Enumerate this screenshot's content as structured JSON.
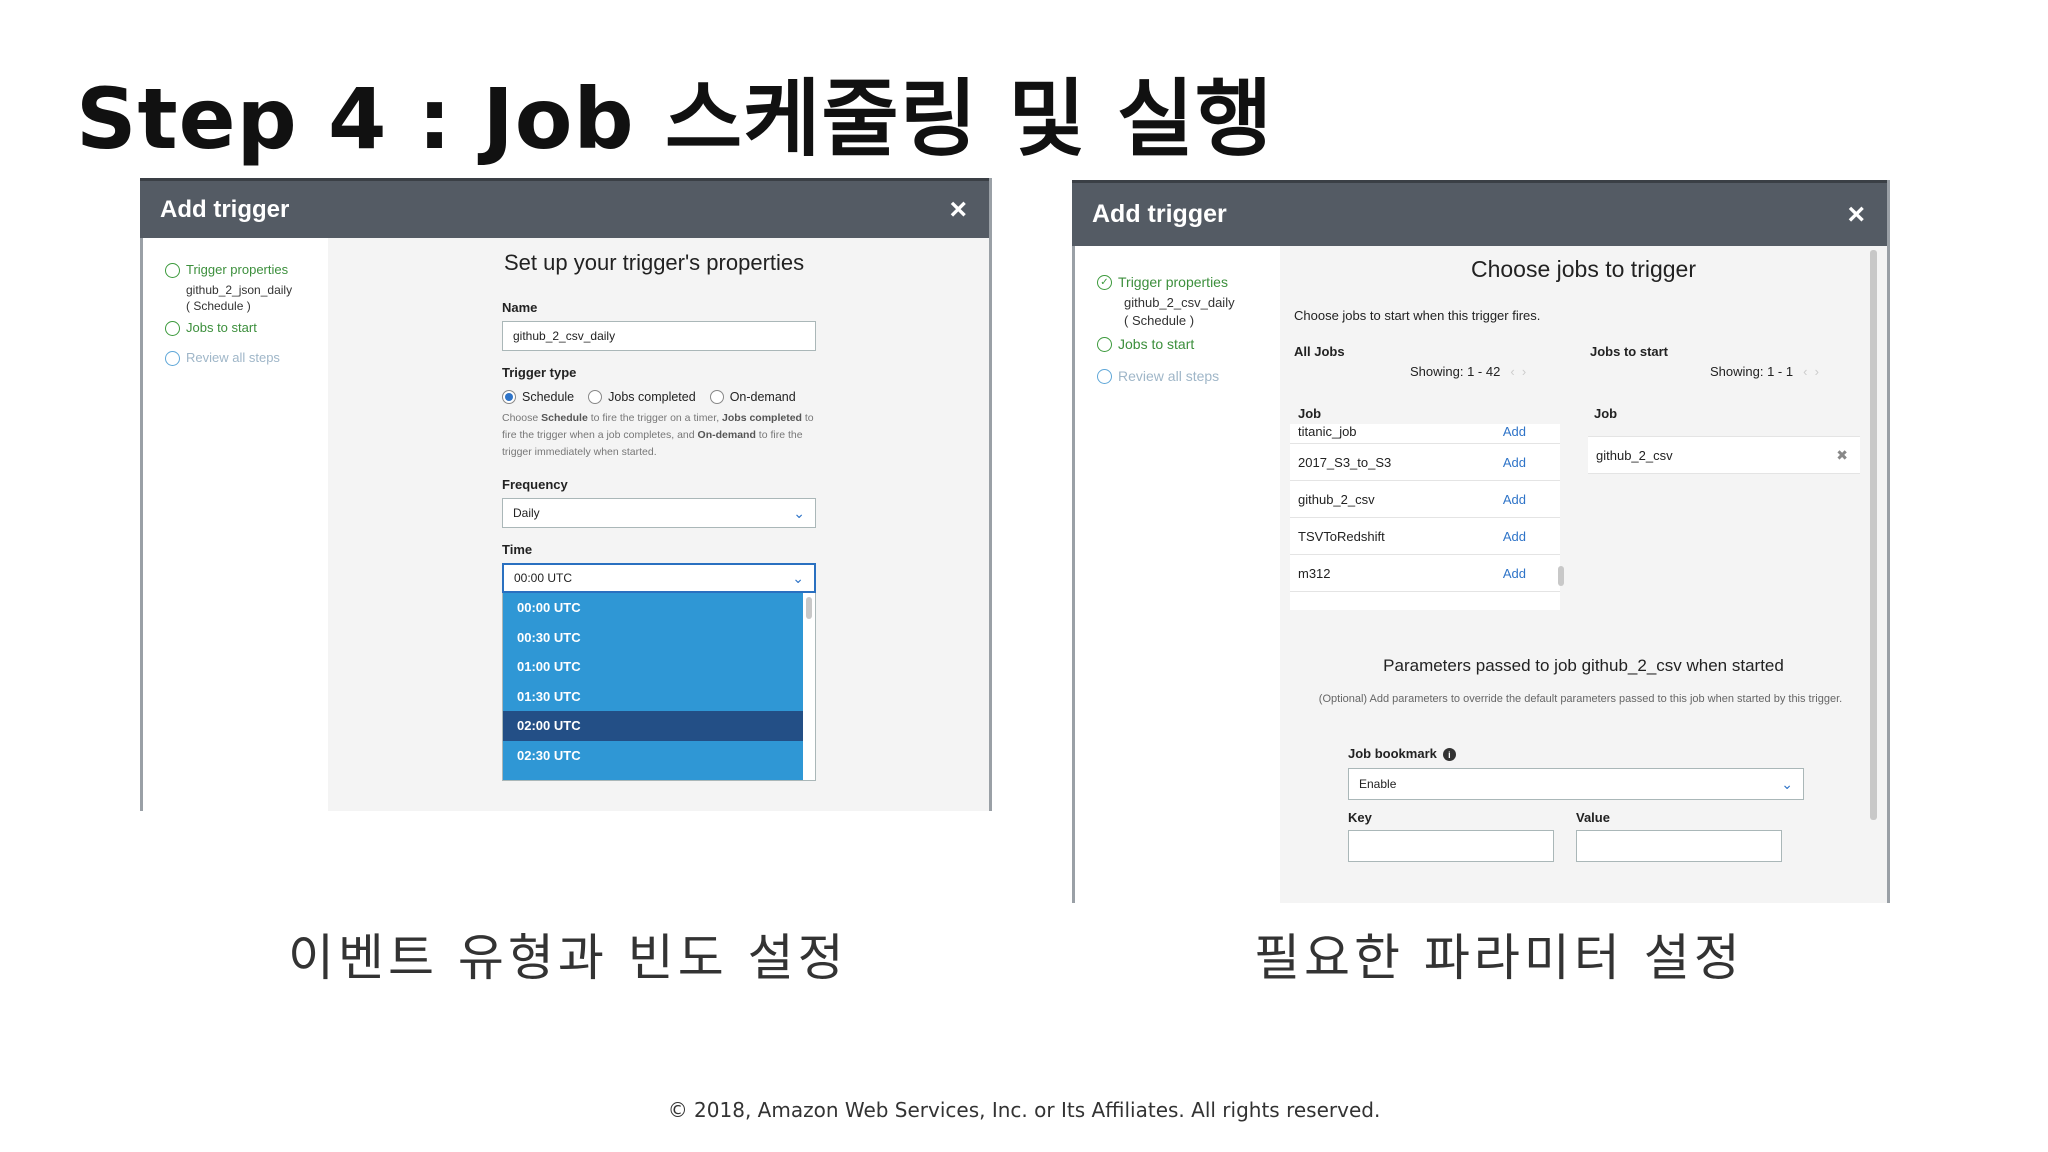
{
  "slide": {
    "title": "Step 4 : Job 스케줄링 및 실행",
    "caption_left": "이벤트 유형과 빈도 설정",
    "caption_right": "필요한 파라미터 설정",
    "footer": "© 2018, Amazon Web Services, Inc. or Its Affiliates. All rights reserved."
  },
  "left_dialog": {
    "title": "Add trigger",
    "close_icon": "×",
    "steps": [
      {
        "label": "Trigger properties",
        "sub": [
          "github_2_json_daily",
          "( Schedule )"
        ]
      },
      {
        "label": "Jobs to start"
      },
      {
        "label": "Review all steps"
      }
    ],
    "heading": "Set up your trigger's properties",
    "name_label": "Name",
    "name_value": "github_2_csv_daily",
    "trigger_type_label": "Trigger type",
    "trigger_options": [
      "Schedule",
      "Jobs completed",
      "On-demand"
    ],
    "selected_trigger": "Schedule",
    "help": {
      "p1": "Choose ",
      "b1": "Schedule",
      "p2": " to fire the trigger on a timer, ",
      "b2": "Jobs completed",
      "p3": " to fire the trigger when a job completes, and ",
      "b3": "On-demand",
      "p4": " to fire the trigger immediately when started."
    },
    "frequency_label": "Frequency",
    "frequency_value": "Daily",
    "time_label": "Time",
    "time_value": "00:00 UTC",
    "time_options": [
      "00:00 UTC",
      "00:30 UTC",
      "01:00 UTC",
      "01:30 UTC",
      "02:00 UTC",
      "02:30 UTC"
    ],
    "time_highlighted": "02:00 UTC"
  },
  "right_dialog": {
    "title": "Add trigger",
    "close_icon": "×",
    "steps": [
      {
        "label": "Trigger properties",
        "sub": [
          "github_2_csv_daily",
          "( Schedule )"
        ]
      },
      {
        "label": "Jobs to start"
      },
      {
        "label": "Review all steps"
      }
    ],
    "heading": "Choose jobs to trigger",
    "description": "Choose jobs to start when this trigger fires.",
    "all_jobs": {
      "title": "All Jobs",
      "showing": "Showing: 1 - 42",
      "column": "Job",
      "add_label": "Add",
      "rows": [
        "titanic_job",
        "2017_S3_to_S3",
        "github_2_csv",
        "TSVToRedshift",
        "m312"
      ]
    },
    "jobs_to_start": {
      "title": "Jobs to start",
      "showing": "Showing: 1 - 1",
      "column": "Job",
      "rows": [
        "github_2_csv"
      ]
    },
    "params_heading": "Parameters passed to job github_2_csv when started",
    "params_help": "(Optional) Add parameters to override the default parameters passed to this job when started by this trigger.",
    "bookmark_label": "Job bookmark",
    "bookmark_value": "Enable",
    "key_label": "Key",
    "value_label": "Value"
  }
}
